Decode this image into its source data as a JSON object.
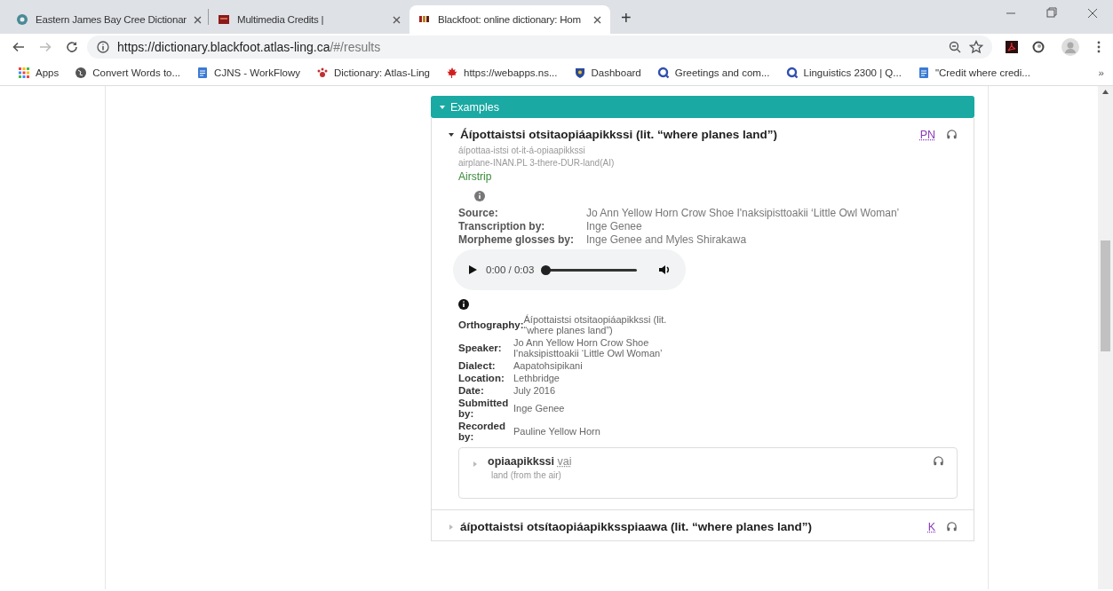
{
  "browser": {
    "tabs": [
      {
        "title": "Eastern James Bay Cree Dictionar",
        "selected": false
      },
      {
        "title": "Multimedia Credits |",
        "selected": false
      },
      {
        "title": "Blackfoot: online dictionary: Hom",
        "selected": true
      }
    ],
    "new_tab": "+",
    "url_host": "https://dictionary.blackfoot.atlas-ling.ca",
    "url_path": "/#/results",
    "bookmarks": [
      {
        "label": "Apps"
      },
      {
        "label": "Convert Words to..."
      },
      {
        "label": "CJNS - WorkFlowy"
      },
      {
        "label": "Dictionary: Atlas-Ling"
      },
      {
        "label": "https://webapps.ns..."
      },
      {
        "label": "Dashboard"
      },
      {
        "label": "Greetings and com..."
      },
      {
        "label": "Linguistics 2300 | Q..."
      },
      {
        "label": "\"Credit where credi..."
      }
    ],
    "bookmarks_more": "»"
  },
  "section": {
    "title": "Examples",
    "expanded": true
  },
  "entries": [
    {
      "title": "Áípottaistsi otsitaopiáapikkssi (lit. “where planes land”)",
      "expanded": true,
      "tag": "PN",
      "morphemes": "áípottaa-istsi ot-it-á-opiaapikkssi",
      "glosses": "airplane-INAN.PL 3-there-DUR-land(AI)",
      "translation": "Airstrip",
      "credits": [
        {
          "label": "Source:",
          "value": "Jo Ann Yellow Horn Crow Shoe I'naksipisttoakii ‘Little Owl Woman’"
        },
        {
          "label": "Transcription by:",
          "value": "Inge Genee"
        },
        {
          "label": "Morpheme glosses by:",
          "value": "Inge Genee and Myles Shirakawa"
        }
      ],
      "audio": {
        "time": "0:00 / 0:03",
        "level": 0.0
      },
      "details": [
        {
          "label": "Orthography:",
          "value": "Áípottaistsi otsitaopiáapikkssi (lit. “where planes land”)"
        },
        {
          "label": "Speaker:",
          "value": "Jo Ann Yellow Horn Crow Shoe I'naksipisttoakii ‘Little Owl Woman’"
        },
        {
          "label": "Dialect:",
          "value": "Aapatohsipikani"
        },
        {
          "label": "Location:",
          "value": "Lethbridge"
        },
        {
          "label": "Date:",
          "value": "July 2016"
        },
        {
          "label": "Submitted by:",
          "value": "Inge Genee"
        },
        {
          "label": "Recorded by:",
          "value": "Pauline Yellow Horn"
        }
      ],
      "words": [
        {
          "word": "opiaapikkssi",
          "pos": "vai",
          "gloss": "land (from the air)",
          "expanded": false
        }
      ]
    },
    {
      "title": "áípottaistsi otsítaopiáapikksspiaawa (lit. “where planes land”)",
      "expanded": false,
      "tag": "K"
    }
  ]
}
